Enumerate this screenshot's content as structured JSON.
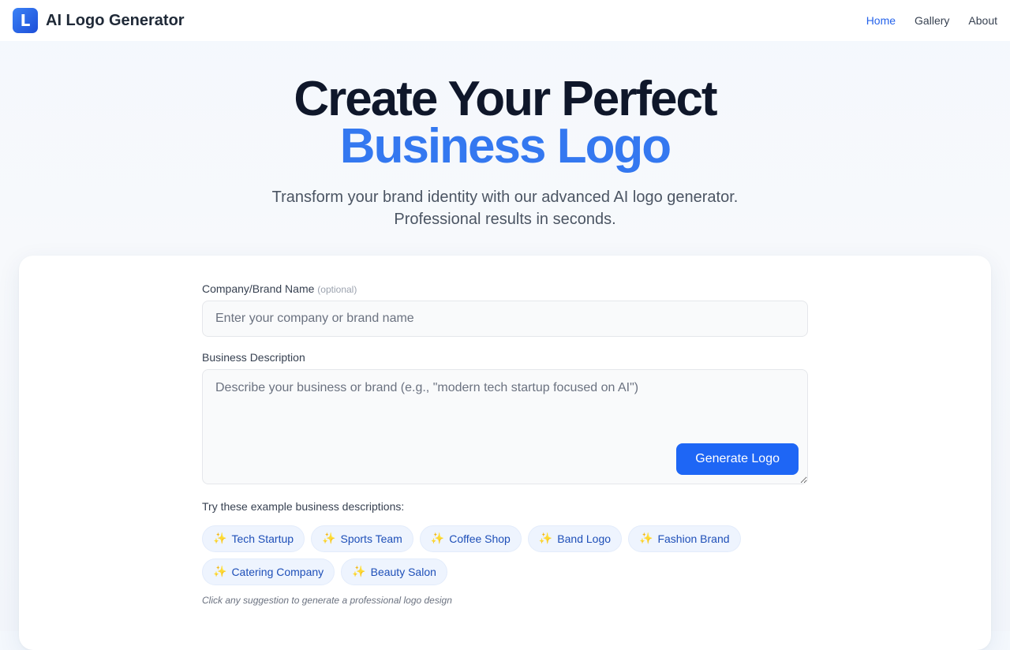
{
  "header": {
    "logo_letter": "L",
    "title": "AI Logo Generator",
    "nav": [
      {
        "label": "Home",
        "active": true
      },
      {
        "label": "Gallery",
        "active": false
      },
      {
        "label": "About",
        "active": false
      }
    ]
  },
  "hero": {
    "line1": "Create Your Perfect",
    "line2": "Business Logo",
    "subtitle_line1": "Transform your brand identity with our advanced AI logo generator.",
    "subtitle_line2": "Professional results in seconds."
  },
  "form": {
    "name_label": "Company/Brand Name",
    "name_optional": "(optional)",
    "name_placeholder": "Enter your company or brand name",
    "name_value": "",
    "desc_label": "Business Description",
    "desc_placeholder": "Describe your business or brand (e.g., \"modern tech startup focused on AI\")",
    "desc_value": "",
    "generate_label": "Generate Logo"
  },
  "examples": {
    "label": "Try these example business descriptions:",
    "icon": "sparkles-icon",
    "icon_glyph": "✨",
    "chips": [
      "Tech Startup",
      "Sports Team",
      "Coffee Shop",
      "Band Logo",
      "Fashion Brand",
      "Catering Company",
      "Beauty Salon"
    ],
    "hint": "Click any suggestion to generate a professional logo design"
  },
  "colors": {
    "accent": "#1e66f5",
    "hero_blue": "#3478f0",
    "chip_bg": "#eef4fe",
    "chip_text": "#1e4fb8"
  }
}
